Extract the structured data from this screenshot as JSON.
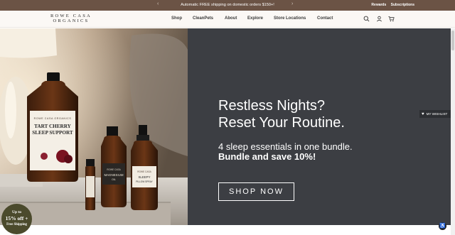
{
  "announcement": {
    "prev_icon": "‹",
    "next_icon": "›",
    "message": "Automatic FREE shipping on domestic orders $150+!",
    "links": [
      "Rewards",
      "Subscriptions"
    ]
  },
  "header": {
    "logo_line1": "ROWE CASA",
    "logo_line2": "ORGANICS",
    "nav": [
      "Shop",
      "CleanPets",
      "About",
      "Explore",
      "Store Locations",
      "Contact"
    ],
    "icons": [
      "search-icon",
      "account-icon",
      "cart-icon"
    ]
  },
  "hero": {
    "headline_line1": "Restless Nights?",
    "headline_line2": "Reset Your Routine.",
    "sub_line1": "4 sleep essentials in one bundle.",
    "sub_line2": "Bundle and save 10%!",
    "cta": "SHOP NOW",
    "products": {
      "big_brand": "ROWE CASA ORGANICS",
      "big_line1": "TART CHERRY",
      "big_line2": "SLEEP SUPPORT",
      "mag_brand": "ROWE CASA",
      "mag_line1": "MAGNESIUM",
      "mag_line2": "OIL",
      "sleepy_brand": "ROWE CASA",
      "sleepy_line1": "SLEEPY",
      "sleepy_line2": "PILLOW SPRAY"
    }
  },
  "wishlist": {
    "label": "MY WISHLIST",
    "icon": "heart-icon"
  },
  "promo": {
    "line1": "Up to",
    "line2": "15% off +",
    "line3": "Free Shipping"
  },
  "accessibility": {
    "icon": "accessibility-icon"
  },
  "colors": {
    "announcement_bg": "#6b5345",
    "hero_panel": "#3c3e43",
    "header_bg": "#fbf8f5",
    "promo_bg": "#4b4a2c"
  }
}
